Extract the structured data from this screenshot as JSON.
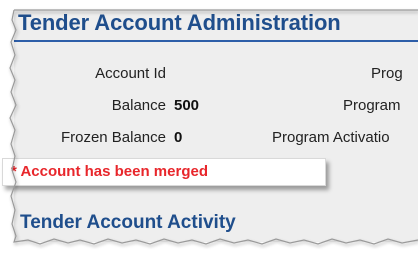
{
  "page": {
    "title": "Tender Account Administration",
    "fields": [
      {
        "label": "Account Id",
        "value": ""
      },
      {
        "label": "Balance",
        "value": "500"
      },
      {
        "label": "Frozen Balance",
        "value": "0"
      }
    ],
    "right_labels": [
      "Prog",
      "Program",
      "Program Activatio"
    ],
    "merged_notice": "* Account has been merged",
    "activity_title": "Tender Account Activity"
  },
  "colors": {
    "title": "#1f4e8c",
    "notice": "#e8262b",
    "panel": "#eeeeee"
  }
}
